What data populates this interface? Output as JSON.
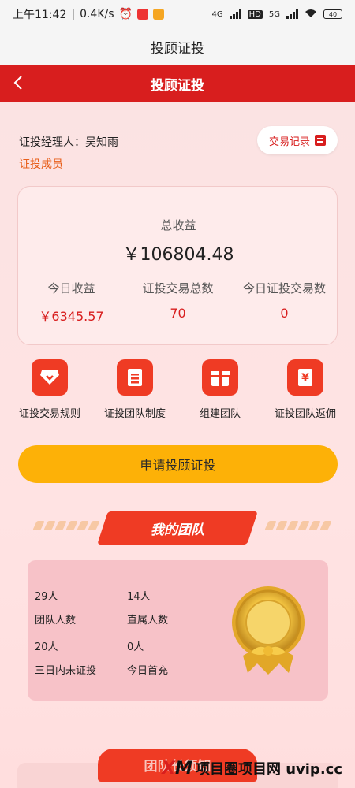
{
  "status_bar": {
    "time": "上午11:42",
    "speed": "0.4K/s",
    "network_1": "4G",
    "hd": "HD",
    "network_2": "5G",
    "battery": "40"
  },
  "window": {
    "title": "投顾证投"
  },
  "header": {
    "title": "投顾证投"
  },
  "manager": {
    "label": "证投经理人：吴知雨",
    "member_tag": "证投成员",
    "trade_record_label": "交易记录"
  },
  "earnings": {
    "total_label": "总收益",
    "total_value": "￥106804.48",
    "stats": [
      {
        "label": "今日收益",
        "value": "￥6345.57"
      },
      {
        "label": "证投交易总数",
        "value": "70"
      },
      {
        "label": "今日证投交易数",
        "value": "0"
      }
    ]
  },
  "menu": [
    {
      "label": "证投交易规则",
      "icon": "diamond-icon"
    },
    {
      "label": "证投团队制度",
      "icon": "document-icon"
    },
    {
      "label": "组建团队",
      "icon": "gift-icon"
    },
    {
      "label": "证投团队返佣",
      "icon": "yen-icon"
    }
  ],
  "apply_button": "申请投顾证投",
  "team_section": {
    "title": "我的团队",
    "stats": [
      {
        "value": "29人",
        "label": "团队人数"
      },
      {
        "value": "14人",
        "label": "直属人数"
      },
      {
        "value": "20人",
        "label": "三日内未证投"
      },
      {
        "value": "0人",
        "label": "今日首充"
      }
    ]
  },
  "bottom_banner": "团队长须知",
  "watermark": {
    "logo_a": "X",
    "logo_b": "M",
    "text": "项目圈项目网 uvip.cc"
  },
  "colors": {
    "primary_red": "#d81e1e",
    "accent_orange": "#fdb107",
    "icon_red": "#ef3b24"
  }
}
